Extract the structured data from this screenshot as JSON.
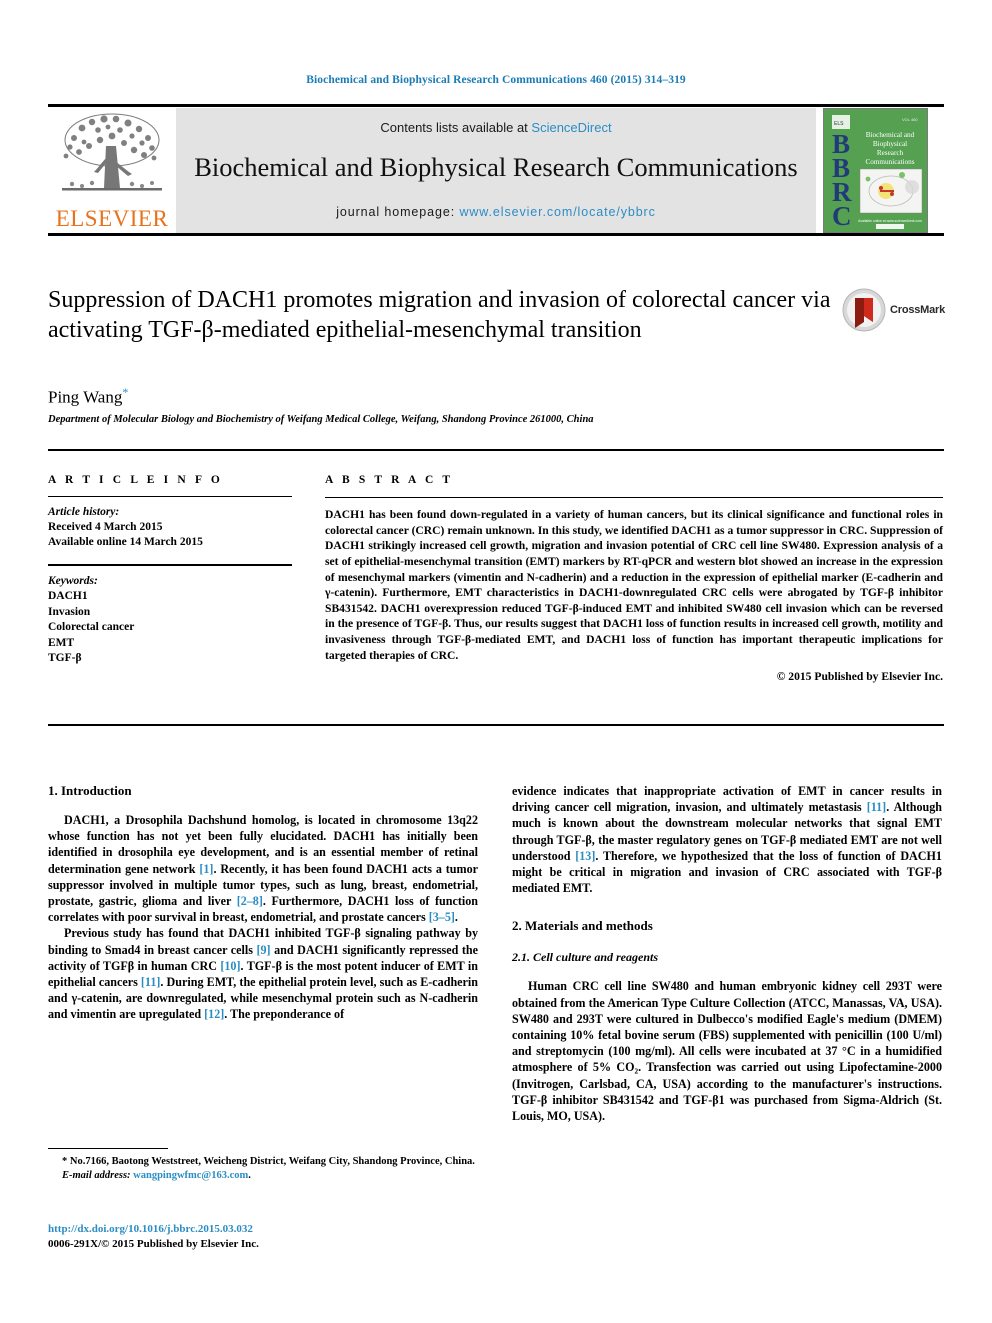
{
  "running_head": "Biochemical and Biophysical Research Communications 460 (2015) 314–319",
  "masthead": {
    "contents_prefix": "Contents lists available at ",
    "sciencedirect": "ScienceDirect",
    "journal_title": "Biochemical and Biophysical Research Communications",
    "homepage_prefix": "journal homepage: ",
    "homepage_url": "www.elsevier.com/locate/ybbrc",
    "publisher_name": "ELSEVIER",
    "cover_acronym": "BBRC",
    "cover_title_lines": [
      "Biochemical and",
      "Biophysical",
      "Research",
      "Communications"
    ],
    "colors": {
      "link": "#2b8dc4",
      "elsevier_orange": "#E9711C",
      "cover_green": "#55A051",
      "band_gray": "#e3e3e3",
      "running_head": "#1a7cb5"
    }
  },
  "title_block": {
    "title": "Suppression of DACH1 promotes migration and invasion of colorectal cancer via activating TGF-β-mediated epithelial-mesenchymal transition",
    "author": "Ping Wang",
    "author_footnote_marker": "*",
    "affiliation": "Department of Molecular Biology and Biochemistry of Weifang Medical College, Weifang, Shandong Province 261000, China",
    "crossmark_label": "CrossMark"
  },
  "article_info": {
    "heading": "A R T I C L E   I N F O",
    "history_label": "Article history:",
    "history_lines": [
      "Received 4 March 2015",
      "Available online 14 March 2015"
    ],
    "keywords_label": "Keywords:",
    "keywords": [
      "DACH1",
      "Invasion",
      "Colorectal cancer",
      "EMT",
      "TGF-β"
    ]
  },
  "abstract": {
    "heading": "A B S T R A C T",
    "text": "DACH1 has been found down-regulated in a variety of human cancers, but its clinical significance and functional roles in colorectal cancer (CRC) remain unknown. In this study, we identified DACH1 as a tumor suppressor in CRC. Suppression of DACH1 strikingly increased cell growth, migration and invasion potential of CRC cell line SW480. Expression analysis of a set of epithelial-mesenchymal transition (EMT) markers by RT-qPCR and western blot showed an increase in the expression of mesenchymal markers (vimentin and N-cadherin) and a reduction in the expression of epithelial marker (E-cadherin and γ-catenin). Furthermore, EMT characteristics in DACH1-downregulated CRC cells were abrogated by TGF-β inhibitor SB431542. DACH1 overexpression reduced TGF-β-induced EMT and inhibited SW480 cell invasion which can be reversed in the presence of TGF-β. Thus, our results suggest that DACH1 loss of function results in increased cell growth, motility and invasiveness through TGF-β-mediated EMT, and DACH1 loss of function has important therapeutic implications for targeted therapies of CRC.",
    "copyright": "© 2015 Published by Elsevier Inc."
  },
  "body": {
    "left": {
      "section_heading": "1.  Introduction",
      "paragraph_1_parts": [
        "DACH1, a Drosophila Dachshund homolog, is located in chromosome 13q22 whose function has not yet been fully elucidated. DACH1 has initially been identified in drosophila eye development, and is an essential member of retinal determination gene network ",
        "[1]",
        ". Recently, it has been found DACH1 acts a tumor suppressor involved in multiple tumor types, such as lung, breast, endometrial, prostate, gastric, glioma and liver ",
        "[2–8]",
        ". Furthermore, DACH1 loss of function correlates with poor survival in breast, endometrial, and prostate cancers ",
        "[3–5]",
        "."
      ],
      "paragraph_2_parts": [
        "Previous study has found that DACH1 inhibited TGF-β signaling pathway by binding to Smad4 in breast cancer cells ",
        "[9]",
        " and DACH1 significantly repressed the activity of TGFβ in human CRC ",
        "[10]",
        ". TGF-β is the most potent inducer of EMT in epithelial cancers ",
        "[11]",
        ". During EMT, the epithelial protein level, such as E-cadherin and γ-catenin, are downregulated, while mesenchymal protein such as N-cadherin and vimentin are upregulated ",
        "[12]",
        ". The preponderance of"
      ]
    },
    "right": {
      "paragraph_continued_parts": [
        "evidence indicates that inappropriate activation of EMT in cancer results in driving cancer cell migration, invasion, and ultimately metastasis ",
        "[11]",
        ". Although much is known about the downstream molecular networks that signal EMT through TGF-β, the master regulatory genes on TGF-β mediated EMT are not well understood ",
        "[13]",
        ". Therefore, we hypothesized that the loss of function of DACH1 might be critical in migration and invasion of CRC associated with TGF-β mediated EMT."
      ],
      "section_heading": "2.  Materials and methods",
      "subsection_heading": "2.1.  Cell culture and reagents",
      "paragraph_1": "Human CRC cell line SW480 and human embryonic kidney cell 293T were obtained from the American Type Culture Collection (ATCC, Manassas, VA, USA). SW480 and 293T were cultured in Dulbecco's modified Eagle's medium (DMEM) containing 10% fetal bovine serum (FBS) supplemented with penicillin (100 U/ml) and streptomycin (100 mg/ml). All cells were incubated at 37 °C in a humidified atmosphere of 5% CO₂. Transfection was carried out using Lipofectamine-2000 (Invitrogen, Carlsbad, CA, USA) according to the manufacturer's instructions. TGF-β inhibitor SB431542 and TGF-β1 was purchased from Sigma-Aldrich (St. Louis, MO, USA)."
    }
  },
  "footer": {
    "corresponding_marker": "*",
    "corresponding_address": " No.7166, Baotong Weststreet, Weicheng District, Weifang City, Shandong Province, China.",
    "email_label": "E-mail address: ",
    "email": "wangpingwfmc@163.com",
    "email_suffix": ".",
    "doi": "http://dx.doi.org/10.1016/j.bbrc.2015.03.032",
    "issn_line": "0006-291X/© 2015 Published by Elsevier Inc."
  }
}
